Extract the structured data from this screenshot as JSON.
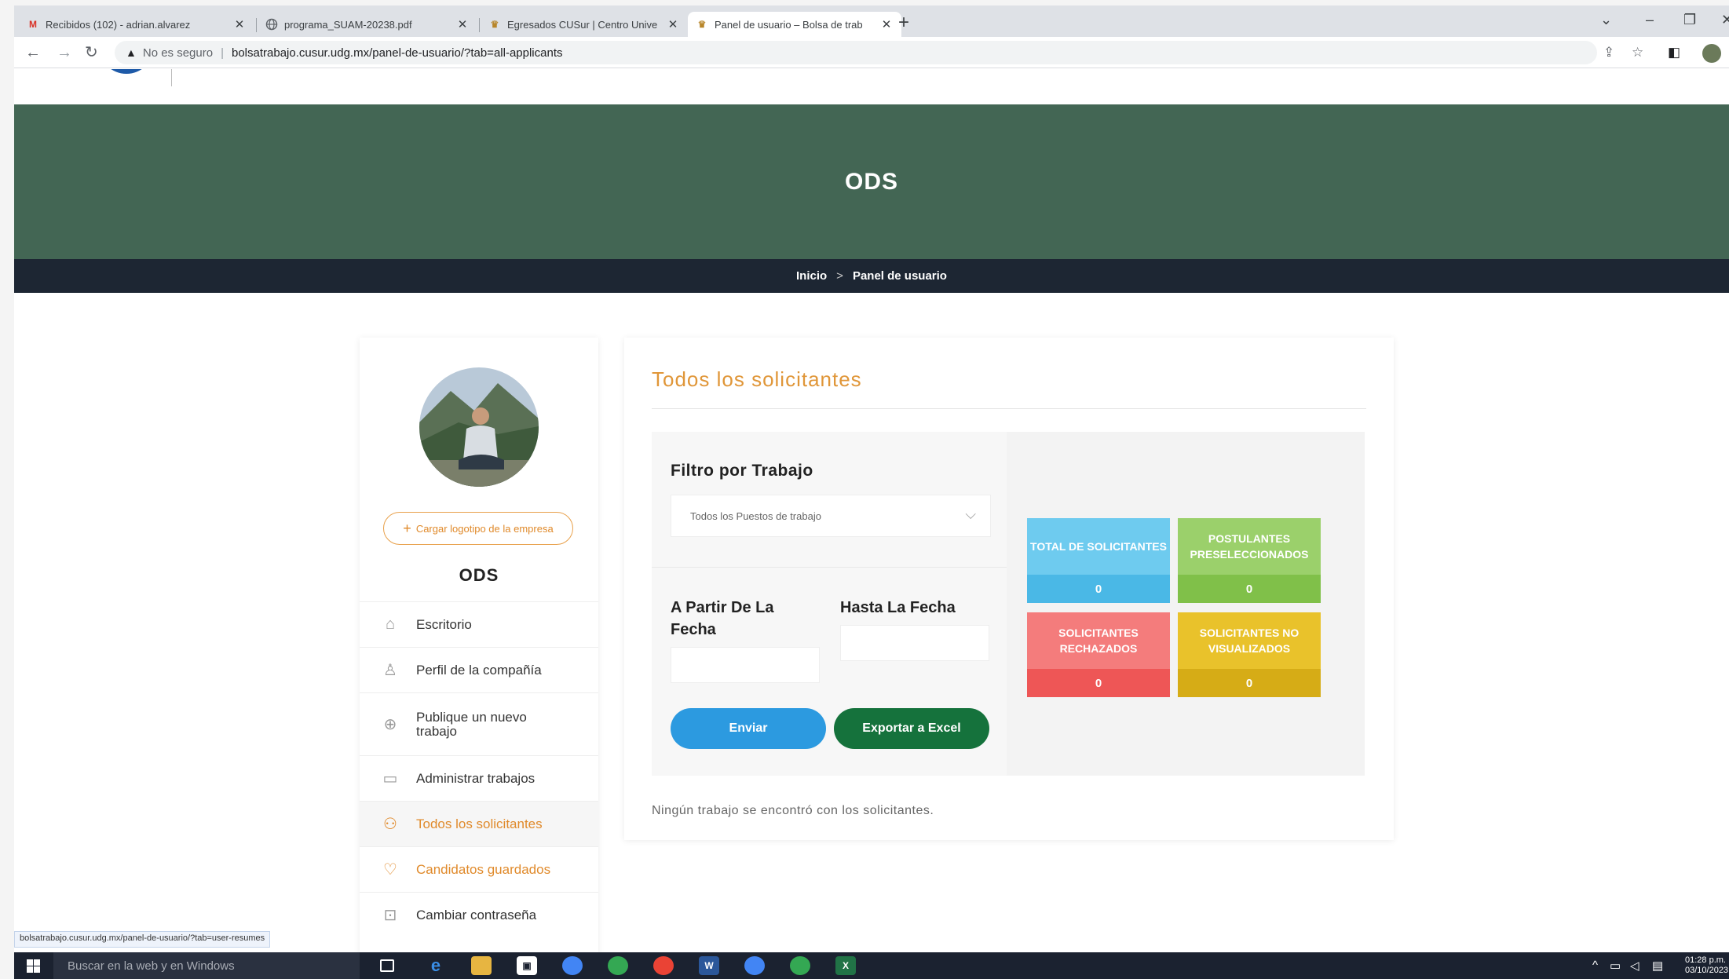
{
  "browser": {
    "tabs": [
      {
        "title": "Recibidos (102) - adrian.alvarez",
        "icon": "gmail-icon"
      },
      {
        "title": "programa_SUAM-20238.pdf",
        "icon": "globe-icon"
      },
      {
        "title": "Egresados CUSur | Centro Unive",
        "icon": "udg-icon"
      },
      {
        "title": "Panel de usuario – Bolsa de trab",
        "icon": "udg-icon",
        "active": true
      }
    ],
    "close_glyph": "✕",
    "new_tab": "+",
    "security_label": "No es seguro",
    "url": "bolsatrabajo.cusur.udg.mx/panel-de-usuario/?tab=all-applicants"
  },
  "site": {
    "hero_title": "ODS",
    "breadcrumb": {
      "home": "Inicio",
      "separator": ">",
      "current": "Panel de usuario"
    }
  },
  "sidebar": {
    "upload_label": "Cargar logotipo de la empresa",
    "company_name": "ODS",
    "items": [
      {
        "label": "Escritorio",
        "icon": "dashboard-icon"
      },
      {
        "label": "Perfil de la compañía",
        "icon": "user-icon"
      },
      {
        "label": "Publique un nuevo trabajo",
        "icon": "plus-circle-icon"
      },
      {
        "label": "Administrar trabajos",
        "icon": "briefcase-icon"
      },
      {
        "label": "Todos los solicitantes",
        "icon": "users-icon",
        "active": true
      },
      {
        "label": "Candidatos guardados",
        "icon": "heart-icon"
      },
      {
        "label": "Cambiar contraseña",
        "icon": "lock-icon"
      }
    ]
  },
  "main": {
    "title": "Todos los solicitantes",
    "filter_heading": "Filtro por Trabajo",
    "job_select_value": "Todos los Puestos de trabajo",
    "from_date_label": "A Partir De La Fecha",
    "to_date_label": "Hasta La Fecha",
    "submit_label": "Enviar",
    "export_label": "Exportar a Excel",
    "stats": [
      {
        "label": "TOTAL DE SOLICITANTES",
        "value": "0",
        "color": "#6ecbef"
      },
      {
        "label": "POSTULANTES PRESELECCIONADOS",
        "value": "0",
        "color": "#9bd06b"
      },
      {
        "label": "SOLICITANTES RECHAZADOS",
        "value": "0",
        "color": "#f47c7c"
      },
      {
        "label": "SOLICITANTES NO VISUALIZADOS",
        "value": "0",
        "color": "#e9c22b"
      }
    ],
    "empty_message": "Ningún trabajo se encontró con los solicitantes."
  },
  "status_url": "bolsatrabajo.cusur.udg.mx/panel-de-usuario/?tab=user-resumes",
  "taskbar": {
    "search_placeholder": "Buscar en la web y en Windows",
    "time": "01:28 p.m.",
    "date": "03/10/2023"
  },
  "colors": {
    "hero": "#436654",
    "breadcrumb_bar": "#1d2633",
    "accent": "#e09638",
    "submit": "#2c9ae0",
    "export": "#15723c"
  }
}
